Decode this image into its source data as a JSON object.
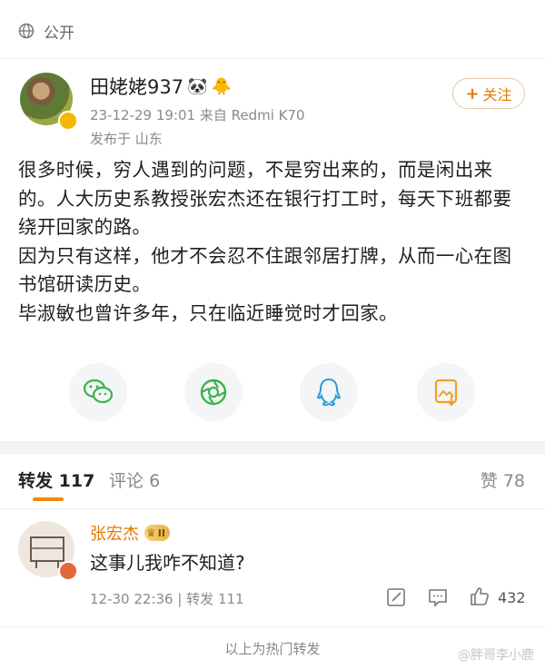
{
  "visibility": {
    "label": "公开",
    "icon": "lock-icon"
  },
  "post": {
    "author": "田姥姥937",
    "author_emojis": [
      "🐼",
      "🐥"
    ],
    "meta": "23-12-29 19:01  来自 Redmi K70",
    "location": "发布于 山东",
    "follow_label": "关注",
    "paragraphs": [
      "很多时候，穷人遇到的问题，不是穷出来的，而是闲出来的。人大历史系教授张宏杰还在银行打工时，每天下班都要绕开回家的路。",
      "因为只有这样，他才不会忍不住跟邻居打牌，从而一心在图书馆研读历史。",
      "毕淑敏也曾许多年，只在临近睡觉时才回家。"
    ]
  },
  "share": [
    {
      "name": "wechat-icon",
      "color": "#3cb34a"
    },
    {
      "name": "moments-icon",
      "color": "#3cb34a"
    },
    {
      "name": "qq-icon",
      "color": "#2f9bd6"
    },
    {
      "name": "save-image-icon",
      "color": "#f0a12a"
    }
  ],
  "tabs": {
    "repost_label": "转发",
    "repost_count": "117",
    "comment_label": "评论",
    "comment_count": "6",
    "like_label": "赞",
    "like_count": "78",
    "accent": "#f08a00"
  },
  "reply": {
    "name": "张宏杰",
    "vip_level": "II",
    "text": "这事儿我咋不知道?",
    "meta": "12-30 22:36 | 转发 111",
    "like_count": "432"
  },
  "footer_note": "以上为热门转发",
  "watermark": "@胖哥李小鹿"
}
